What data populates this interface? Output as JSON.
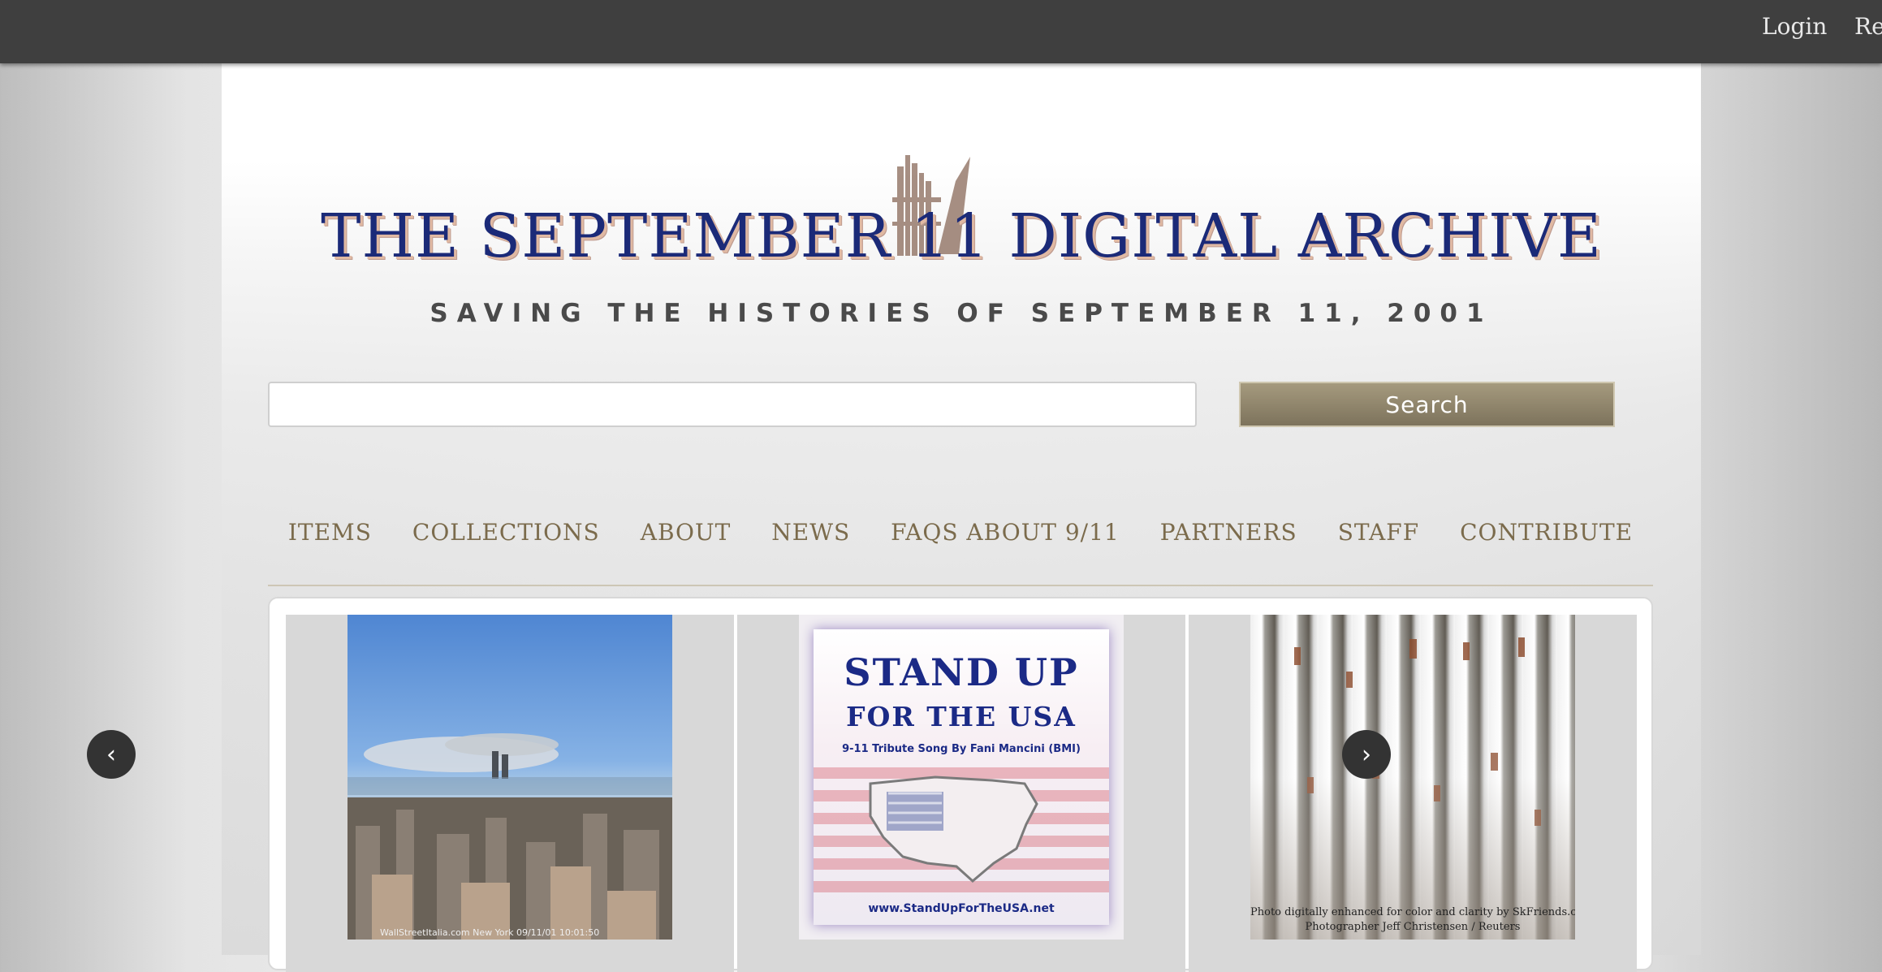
{
  "topbar": {
    "login_label": "Login",
    "register_label": "Re"
  },
  "logo": {
    "title": "THE SEPTEMBER 11 DIGITAL ARCHIVE",
    "subtitle": "SAVING THE HISTORIES OF SEPTEMBER 11, 2001"
  },
  "search": {
    "value": "",
    "placeholder": "",
    "button_label": "Search"
  },
  "nav": {
    "items": [
      {
        "label": "ITEMS"
      },
      {
        "label": "COLLECTIONS"
      },
      {
        "label": "ABOUT"
      },
      {
        "label": "NEWS"
      },
      {
        "label": "FAQS ABOUT 9/11"
      },
      {
        "label": "PARTNERS"
      },
      {
        "label": "STAFF"
      },
      {
        "label": "CONTRIBUTE"
      }
    ]
  },
  "carousel": {
    "prev_label": "‹",
    "next_label": "›",
    "slides": [
      {
        "caption": "WallStreetItalia.com New York 09/11/01 10:01:50"
      },
      {
        "line1": "STAND UP",
        "line2": "FOR THE USA",
        "line3": "9-11 Tribute Song By Fani Mancini (BMI)",
        "url": "www.StandUpForTheUSA.net"
      },
      {
        "caption_1": "Photo digitally enhanced for color and clarity by SkFriends.co",
        "caption_2": "Photographer Jeff Christensen / Reuters"
      }
    ]
  },
  "colors": {
    "topbar": "#3f3f3f",
    "accent": "#7b6b4c",
    "search_button": "#8f846b",
    "logo_title": "#1b2a78"
  }
}
